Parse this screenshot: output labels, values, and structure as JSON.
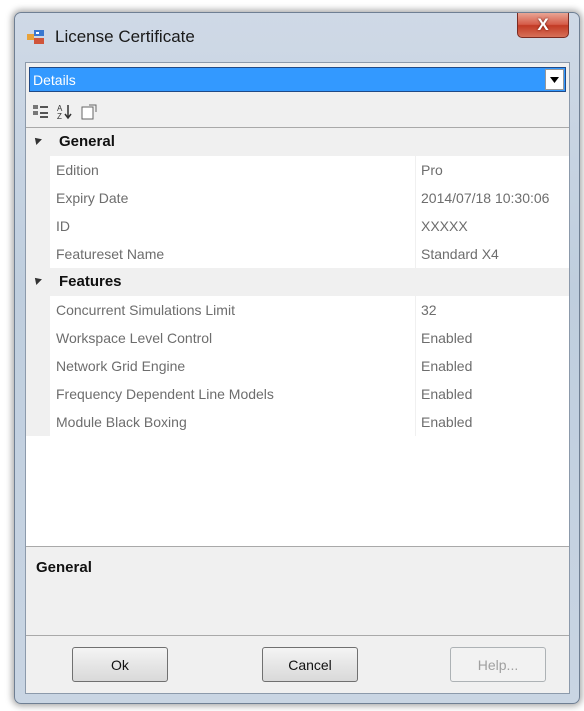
{
  "window": {
    "title": "License Certificate",
    "close_label": "X"
  },
  "dropdown": {
    "value": "Details"
  },
  "toolbar": {
    "icons": [
      "categorized-icon",
      "alphabetical-sort-icon",
      "property-pages-icon"
    ]
  },
  "categories": [
    {
      "label": "General",
      "properties": [
        {
          "name": "Edition",
          "value": "Pro"
        },
        {
          "name": "Expiry Date",
          "value": "2014/07/18 10:30:06"
        },
        {
          "name": "ID",
          "value": "XXXXX"
        },
        {
          "name": "Featureset Name",
          "value": "Standard X4"
        }
      ]
    },
    {
      "label": "Features",
      "properties": [
        {
          "name": "Concurrent Simulations Limit",
          "value": "32"
        },
        {
          "name": "Workspace Level Control",
          "value": "Enabled"
        },
        {
          "name": "Network Grid Engine",
          "value": "Enabled"
        },
        {
          "name": "Frequency Dependent Line Models",
          "value": "Enabled"
        },
        {
          "name": "Module Black Boxing",
          "value": "Enabled"
        }
      ]
    }
  ],
  "description": {
    "title": "General"
  },
  "buttons": {
    "ok_label": "Ok",
    "cancel_label": "Cancel",
    "help_label": "Help..."
  },
  "colors": {
    "selection": "#3399ff",
    "category_bg": "#f0f0f0",
    "close_button": "#c23a24"
  }
}
